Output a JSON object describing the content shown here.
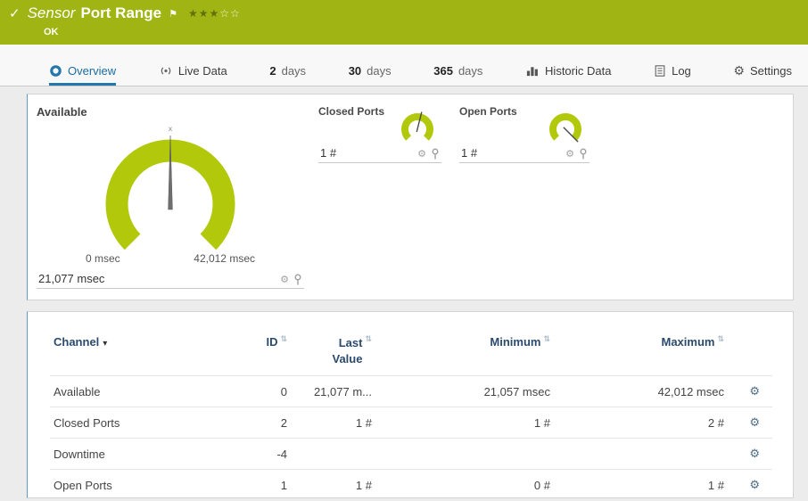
{
  "icons": {
    "check": "✓",
    "flag": "⚑",
    "gear": "⚙",
    "sort": "⇅",
    "sort_active": "▾",
    "needle_marker": "x"
  },
  "header": {
    "kind": "Sensor",
    "title": "Port Range",
    "status": "OK",
    "stars_filled": "★★★",
    "stars_empty": "☆☆"
  },
  "tabs": {
    "overview": "Overview",
    "live_data": "Live Data",
    "days2_num": "2",
    "days2_label": "days",
    "days30_num": "30",
    "days30_label": "days",
    "days365_num": "365",
    "days365_label": "days",
    "historic": "Historic Data",
    "log": "Log",
    "settings": "Settings"
  },
  "gauges": {
    "available": {
      "title": "Available",
      "value": "21,077 msec",
      "min": "0 msec",
      "max": "42,012 msec"
    },
    "closed_ports": {
      "title": "Closed Ports",
      "value": "1 #"
    },
    "open_ports": {
      "title": "Open Ports",
      "value": "1 #"
    }
  },
  "table": {
    "headers": {
      "channel": "Channel",
      "id": "ID",
      "last_value": "Last Value",
      "minimum": "Minimum",
      "maximum": "Maximum"
    },
    "rows": [
      {
        "channel": "Available",
        "id": "0",
        "last": "21,077 m...",
        "min": "21,057 msec",
        "max": "42,012 msec"
      },
      {
        "channel": "Closed Ports",
        "id": "2",
        "last": "1 #",
        "min": "1 #",
        "max": "2 #"
      },
      {
        "channel": "Downtime",
        "id": "-4",
        "last": "",
        "min": "",
        "max": ""
      },
      {
        "channel": "Open Ports",
        "id": "1",
        "last": "1 #",
        "min": "0 #",
        "max": "1 #"
      }
    ]
  },
  "colors": {
    "header_green": "#a0b513",
    "gauge_green": "#b2c90b",
    "active_tab_blue": "#2277ad",
    "table_header_navy": "#2b4a6d"
  }
}
